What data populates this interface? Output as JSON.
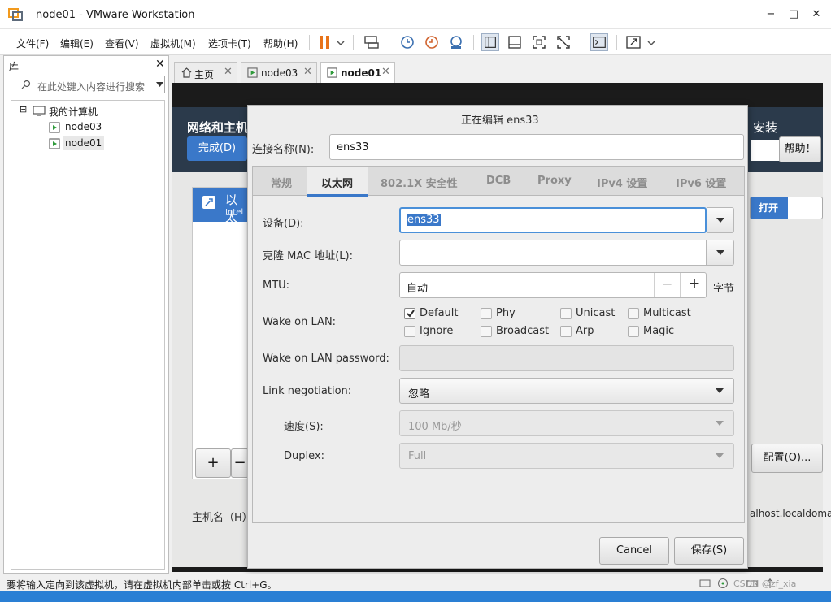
{
  "window": {
    "title": "node01 - VMware Workstation",
    "minimize": "−",
    "maximize": "□",
    "close": "✕"
  },
  "menu": [
    "文件(F)",
    "编辑(E)",
    "查看(V)",
    "虚拟机(M)",
    "选项卡(T)",
    "帮助(H)"
  ],
  "library": {
    "title": "库",
    "close": "✕",
    "search_placeholder": "在此处键入内容进行搜索",
    "tree": {
      "root": "我的计算机",
      "items": [
        "node03",
        "node01"
      ],
      "toggle": "⊟"
    }
  },
  "tabs": [
    {
      "label": "主页",
      "close": "✕"
    },
    {
      "label": "node03",
      "close": "✕"
    },
    {
      "label": "node01",
      "close": "✕"
    }
  ],
  "vm": {
    "header_title": "网络和主机",
    "done_button": "完成(D)",
    "install_label": "安装",
    "help_button": "帮助！",
    "net_item_title": "以太",
    "net_item_sub": "Intel",
    "toggle_on": "打开",
    "add": "+",
    "remove": "−",
    "config_button": "配置(O)...",
    "hostname_label": "主机名（H）",
    "hostname_value": "alhost.localdoma"
  },
  "dialog": {
    "title": "正在编辑 ens33",
    "conn_name_label": "连接名称(N):",
    "conn_name_value": "ens33",
    "tabs": [
      "常规",
      "以太网",
      "802.1X 安全性",
      "DCB",
      "Proxy",
      "IPv4 设置",
      "IPv6 设置"
    ],
    "device_label": "设备(D):",
    "device_value": "ens33",
    "clone_mac_label": "克隆 MAC 地址(L):",
    "mtu_label": "MTU:",
    "mtu_value": "自动",
    "mtu_minus": "−",
    "mtu_plus": "+",
    "mtu_unit": "字节",
    "wol_label": "Wake on LAN:",
    "wol_options": [
      "Default",
      "Phy",
      "Unicast",
      "Multicast",
      "Ignore",
      "Broadcast",
      "Arp",
      "Magic"
    ],
    "wol_password_label": "Wake on LAN password:",
    "link_neg_label": "Link negotiation:",
    "link_neg_value": "忽略",
    "speed_label": "速度(S):",
    "speed_value": "100 Mb/秒",
    "duplex_label": "Duplex:",
    "duplex_value": "Full",
    "cancel": "Cancel",
    "save": "保存(S)"
  },
  "statusbar": {
    "text": "要将输入定向到该虚拟机，请在虚拟机内部单击或按 Ctrl+G。",
    "watermark": "CSDN @zf_xia"
  },
  "colors": {
    "accent": "#3a78c9",
    "vm_header": "#2b3a4b",
    "pause": "#e8731a"
  }
}
